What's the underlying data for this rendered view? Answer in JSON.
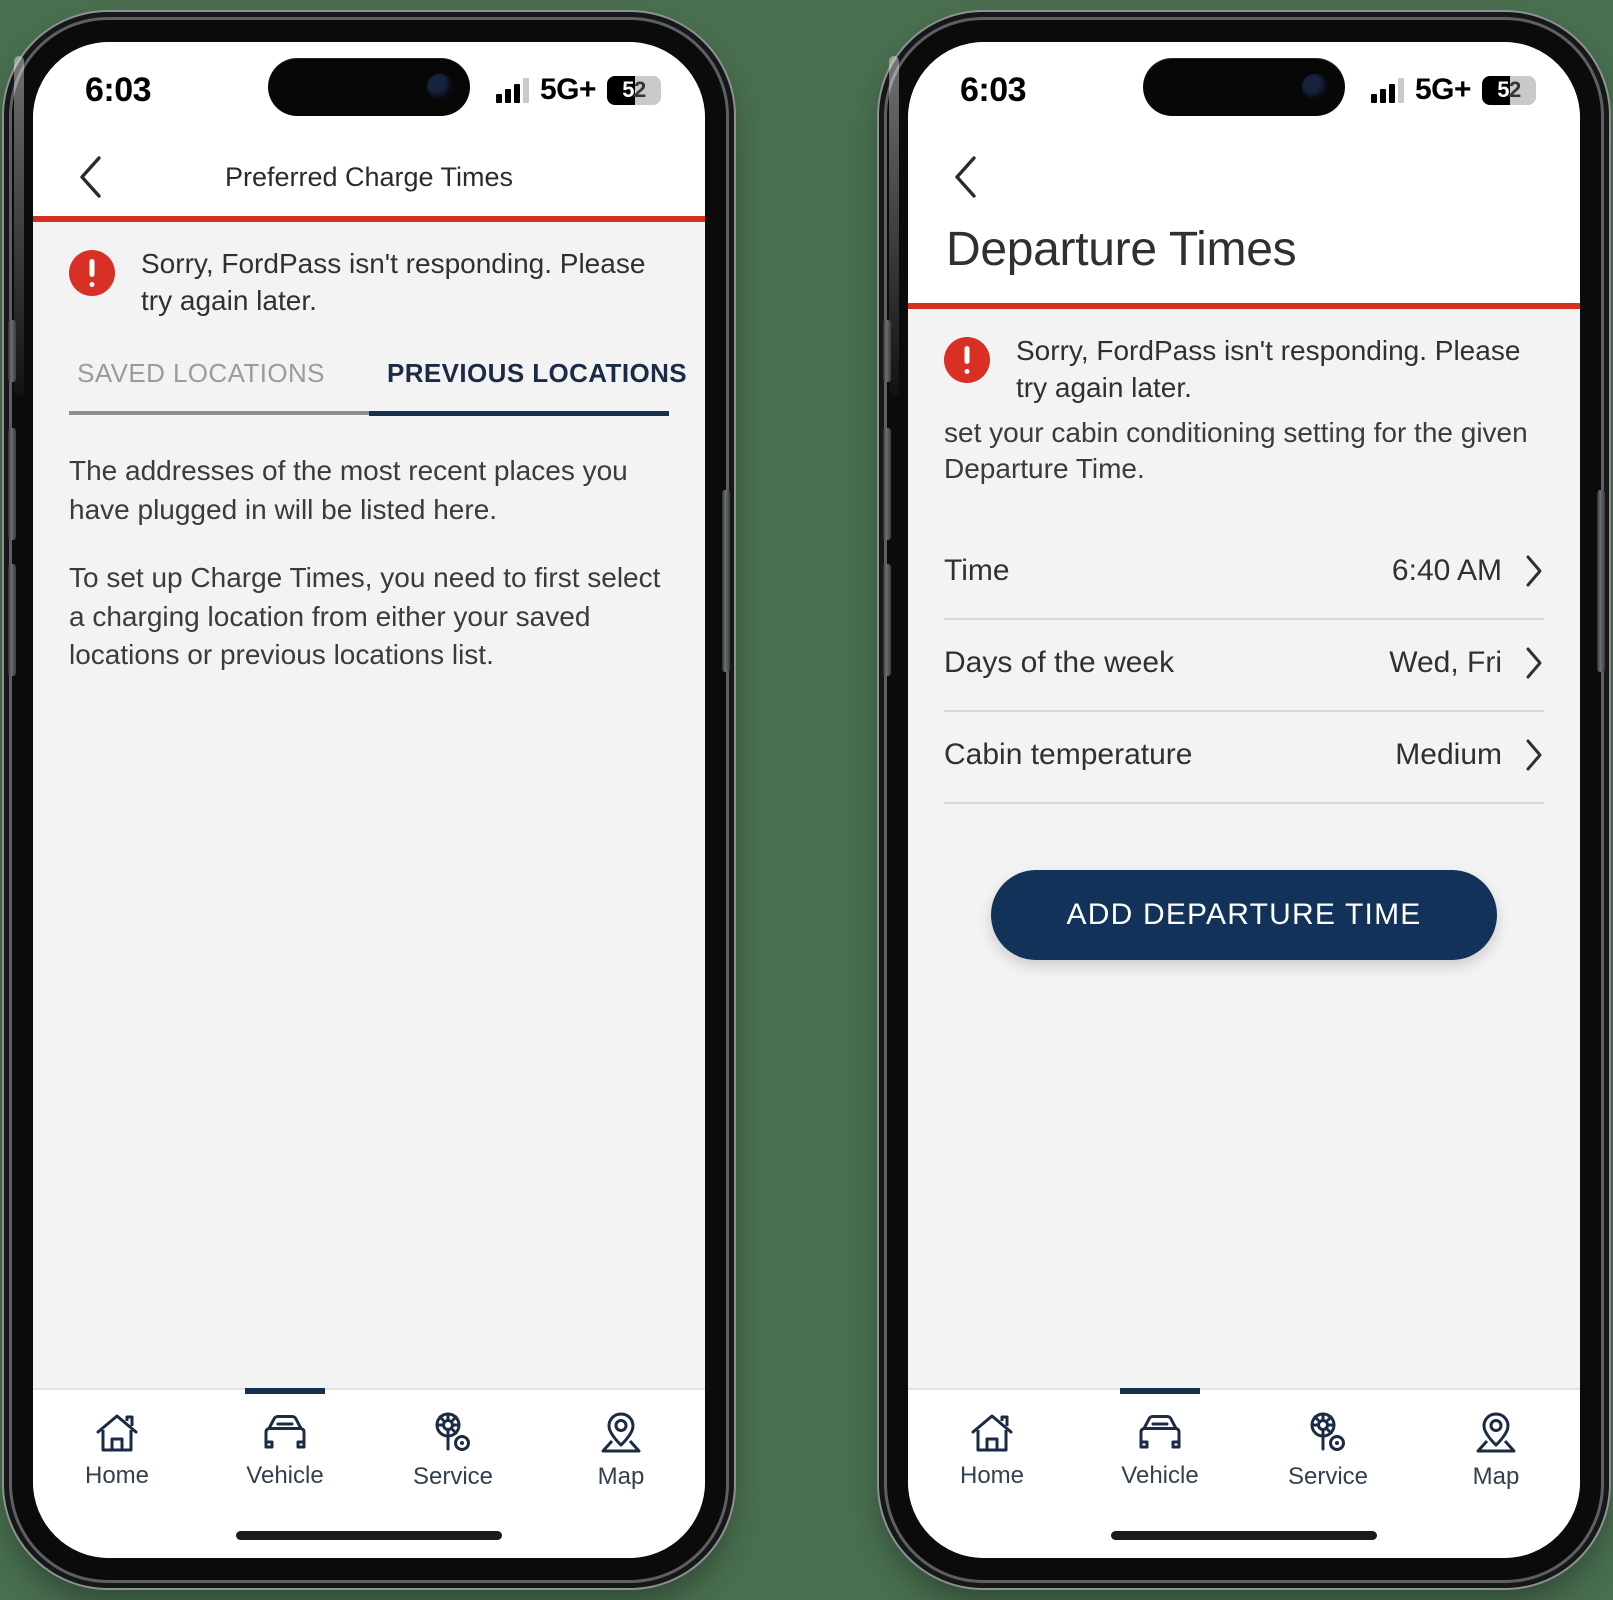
{
  "theme": {
    "page_background": "#4a7050",
    "brand_red": "#d6301f",
    "brand_navy": "#12325a",
    "alert_red": "#d93025",
    "screen_gray": "#f3f3f3"
  },
  "phones": [
    {
      "status_bar": {
        "time": "6:03",
        "network": "5G+",
        "battery_percent": "52",
        "battery_level": 52,
        "signal_icon": "cellular-bars-icon",
        "battery_icon": "battery-icon"
      },
      "nav": {
        "back_icon": "chevron-left-icon",
        "title": "Preferred Charge Times"
      },
      "alert": {
        "icon": "error-exclamation-icon",
        "message": "Sorry, FordPass isn't responding. Please try again later."
      },
      "tabs": [
        {
          "label": "SAVED LOCATIONS",
          "active": false
        },
        {
          "label": "PREVIOUS LOCATIONS",
          "active": true
        }
      ],
      "body": [
        "The addresses of the most recent places you have plugged in will be listed here.",
        " To set up Charge Times, you need to first select a charging location from either your saved locations or previous locations list."
      ],
      "tabbar": [
        {
          "label": "Home",
          "icon": "home-icon",
          "active": false
        },
        {
          "label": "Vehicle",
          "icon": "car-icon",
          "active": true
        },
        {
          "label": "Service",
          "icon": "wrench-gear-icon",
          "active": false
        },
        {
          "label": "Map",
          "icon": "map-pin-icon",
          "active": false
        }
      ]
    },
    {
      "status_bar": {
        "time": "6:03",
        "network": "5G+",
        "battery_percent": "52",
        "battery_level": 52,
        "signal_icon": "cellular-bars-icon",
        "battery_icon": "battery-icon"
      },
      "nav": {
        "back_icon": "chevron-left-icon",
        "title": ""
      },
      "page_title": "Departure Times",
      "alert": {
        "icon": "error-exclamation-icon",
        "message": "Sorry, FordPass isn't responding. Please try again later."
      },
      "description_clipped": "set your cabin conditioning setting for the given Departure Time.",
      "rows": [
        {
          "label": "Time",
          "value": "6:40 AM",
          "chevron": "chevron-right-icon"
        },
        {
          "label": "Days of the week",
          "value": "Wed, Fri",
          "chevron": "chevron-right-icon"
        },
        {
          "label": "Cabin temperature",
          "value": "Medium",
          "chevron": "chevron-right-icon"
        }
      ],
      "cta": {
        "label": "ADD DEPARTURE TIME"
      },
      "tabbar": [
        {
          "label": "Home",
          "icon": "home-icon",
          "active": false
        },
        {
          "label": "Vehicle",
          "icon": "car-icon",
          "active": true
        },
        {
          "label": "Service",
          "icon": "wrench-gear-icon",
          "active": false
        },
        {
          "label": "Map",
          "icon": "map-pin-icon",
          "active": false
        }
      ]
    }
  ]
}
